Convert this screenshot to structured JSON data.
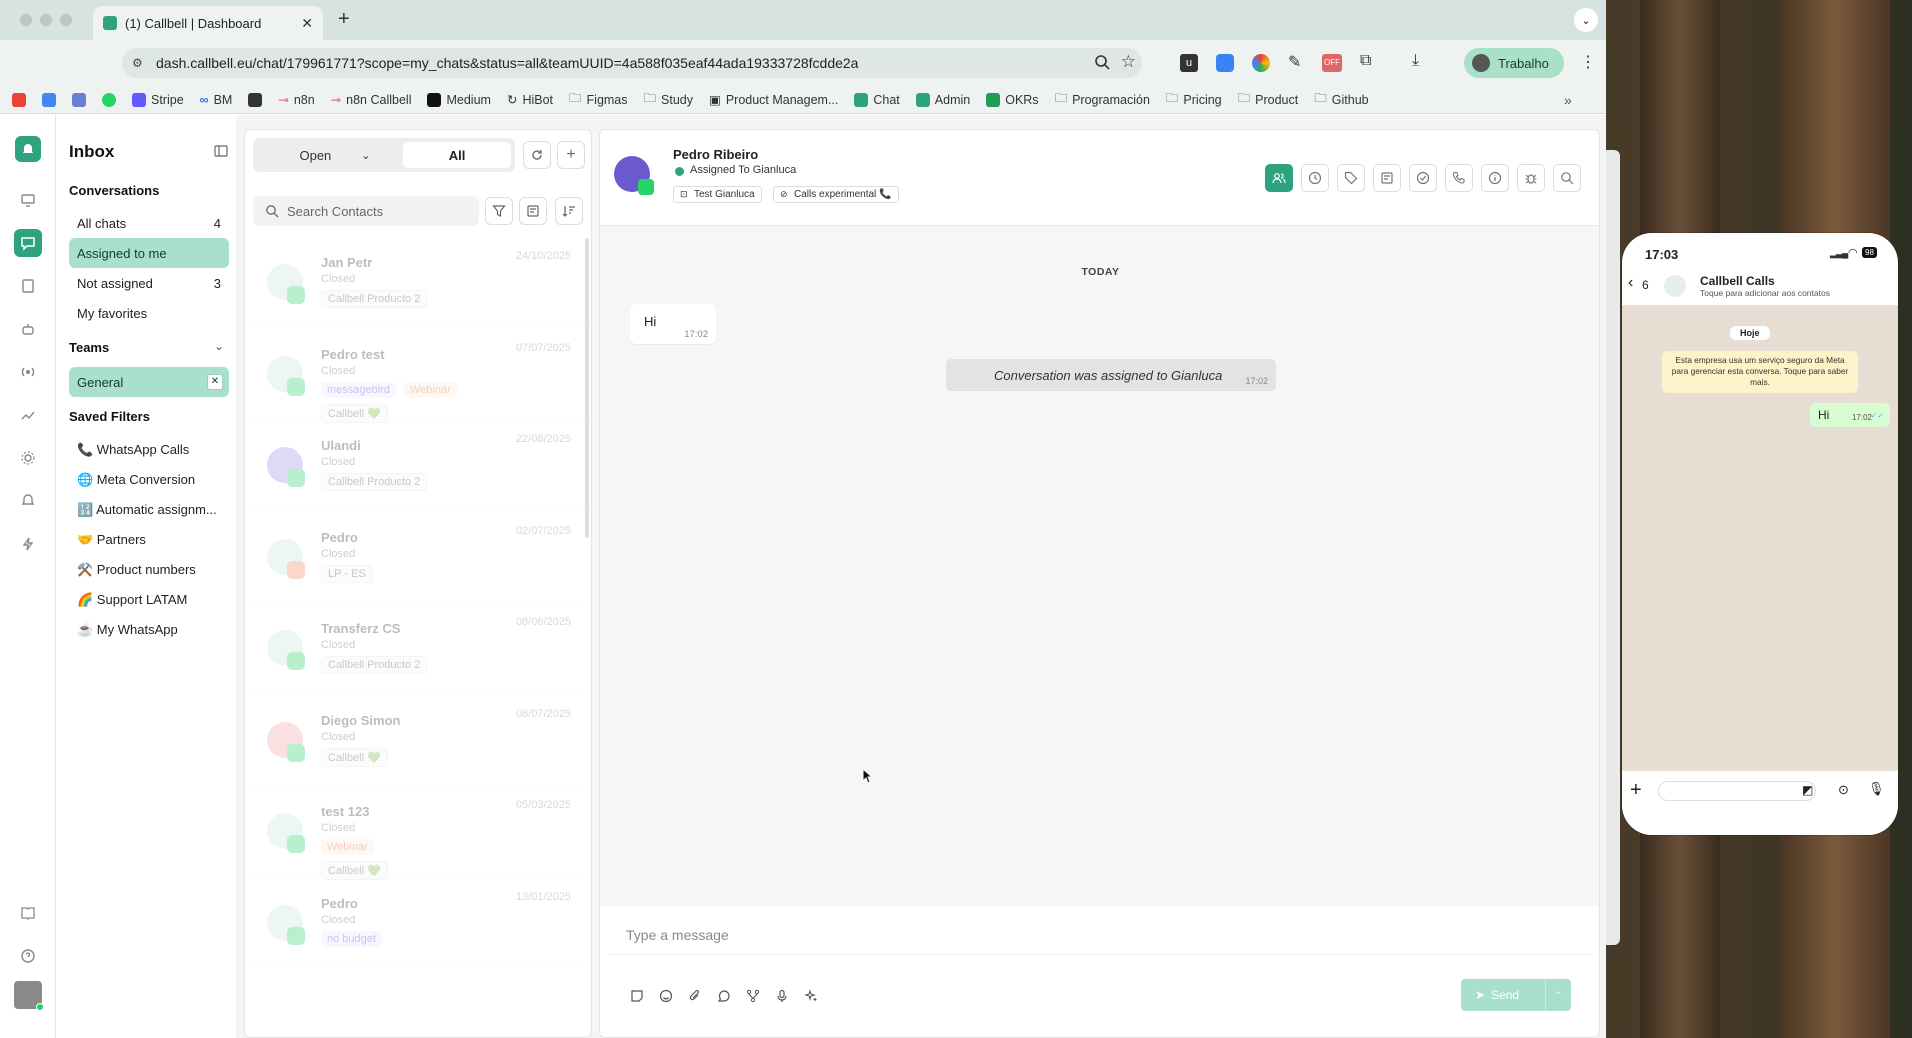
{
  "browser": {
    "tab_title": "(1) Callbell | Dashboard",
    "url": "dash.callbell.eu/chat/179961771?scope=my_chats&status=all&teamUUID=4a588f035eaf44ada19333728fcdde2a",
    "profile_label": "Trabalho",
    "bookmarks": [
      "Stripe",
      "BM",
      "n8n",
      "n8n Callbell",
      "Medium",
      "HiBot",
      "Figmas",
      "Study",
      "Product Managem...",
      "Chat",
      "Admin",
      "OKRs",
      "Programación",
      "Pricing",
      "Product",
      "Github"
    ],
    "more_bookmarks": "»"
  },
  "inbox": {
    "title": "Inbox",
    "conversations_header": "Conversations",
    "items": [
      {
        "label": "All chats",
        "count": "4"
      },
      {
        "label": "Assigned to me",
        "count": ""
      },
      {
        "label": "Not assigned",
        "count": "3"
      },
      {
        "label": "My favorites",
        "count": ""
      }
    ],
    "teams_header": "Teams",
    "team": "General",
    "saved_filters_header": "Saved Filters",
    "saved_filters": [
      "📞 WhatsApp Calls",
      "🌐 Meta Conversion",
      "🔢 Automatic assignm...",
      "🤝 Partners",
      "⚒️ Product numbers",
      "🌈 Support LATAM",
      "☕ My WhatsApp"
    ]
  },
  "chatlist": {
    "status_select": "Open",
    "scope_active": "All",
    "search_placeholder": "Search Contacts",
    "chats": [
      {
        "name": "Jan Petr",
        "status": "Closed",
        "date": "24/10/2025",
        "tags": [
          "Callbell Producto 2"
        ]
      },
      {
        "name": "Pedro test",
        "status": "Closed",
        "date": "07/07/2025",
        "tags": [
          "messagebird",
          "Webinar",
          "Callbell 💚"
        ]
      },
      {
        "name": "Ulandi",
        "status": "Closed",
        "date": "22/08/2025",
        "tags": [
          "Callbell Producto 2"
        ]
      },
      {
        "name": "Pedro",
        "status": "Closed",
        "date": "02/07/2025",
        "tags": [
          "LP - ES"
        ]
      },
      {
        "name": "Transferz CS",
        "status": "Closed",
        "date": "08/06/2025",
        "tags": [
          "Callbell Producto 2"
        ]
      },
      {
        "name": "Diego Simon",
        "status": "Closed",
        "date": "08/07/2025",
        "tags": [
          "Callbell 💚"
        ]
      },
      {
        "name": "test 123",
        "status": "Closed",
        "date": "05/03/2025",
        "tags": [
          "Webinar",
          "Callbell 💚"
        ]
      },
      {
        "name": "Pedro",
        "status": "Closed",
        "date": "13/01/2025",
        "tags": [
          "no budget"
        ]
      }
    ]
  },
  "conversation": {
    "contact_name": "Pedro Ribeiro",
    "assigned_text": "Assigned To Gianluca",
    "tags": [
      "Test Gianluca",
      "Calls experimental 📞"
    ],
    "day_separator": "TODAY",
    "message_text": "Hi",
    "message_time": "17:02",
    "system_message": "Conversation was assigned to Gianluca",
    "system_time": "17:02",
    "composer_placeholder": "Type a message",
    "send_label": "Send"
  },
  "phone": {
    "time": "17:03",
    "battery": "98",
    "back_count": "6",
    "contact": "Callbell Calls",
    "contact_sub": "Toque para adicionar aos contatos",
    "date_chip": "Hoje",
    "security_notice": "Esta empresa usa um serviço seguro da Meta para gerenciar esta conversa. Toque para saber mais.",
    "message_text": "Hi",
    "message_time": "17:02"
  },
  "colors": {
    "brand": "#2fa37f",
    "active_nav": "#a8dfcf",
    "whatsapp": "#25d366",
    "chat_bg": "#e7ddd2",
    "outgoing_bubble": "#d9fdd3"
  }
}
